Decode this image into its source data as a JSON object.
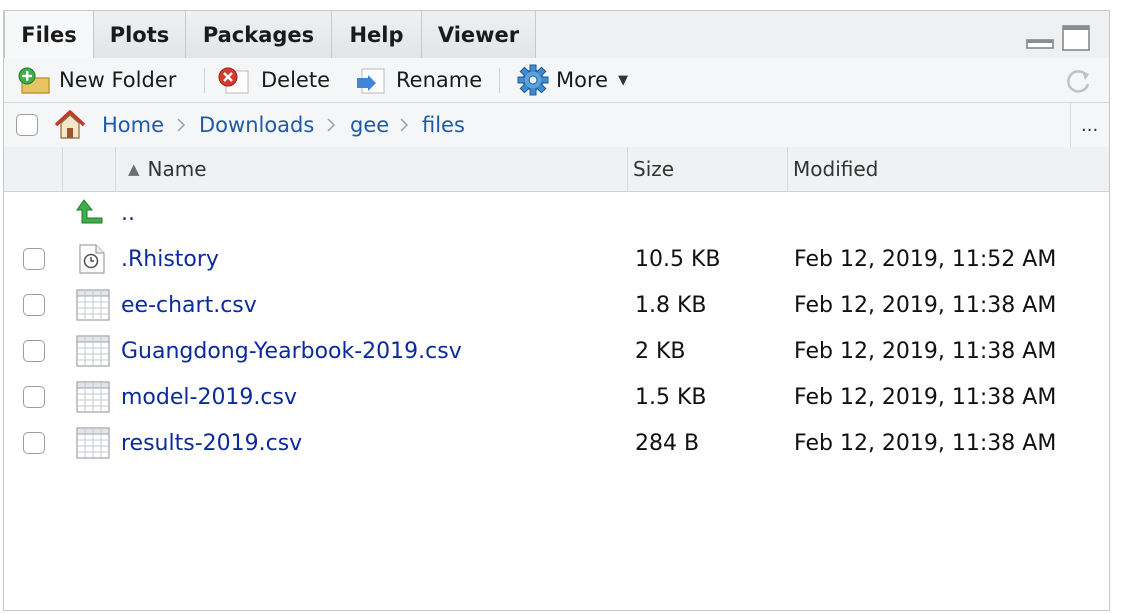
{
  "tabs": [
    {
      "label": "Files",
      "active": true
    },
    {
      "label": "Plots",
      "active": false
    },
    {
      "label": "Packages",
      "active": false
    },
    {
      "label": "Help",
      "active": false
    },
    {
      "label": "Viewer",
      "active": false
    }
  ],
  "toolbar": {
    "new_folder_label": "New Folder",
    "delete_label": "Delete",
    "rename_label": "Rename",
    "more_label": "More",
    "overflow_label": "..."
  },
  "breadcrumb": [
    "Home",
    "Downloads",
    "gee",
    "files"
  ],
  "columns": {
    "name": "Name",
    "size": "Size",
    "modified": "Modified"
  },
  "parent_dir_label": "..",
  "files": [
    {
      "name": ".Rhistory",
      "size": "10.5 KB",
      "modified": "Feb 12, 2019, 11:52 AM",
      "icon": "history-file-icon"
    },
    {
      "name": "ee-chart.csv",
      "size": "1.8 KB",
      "modified": "Feb 12, 2019, 11:38 AM",
      "icon": "csv-file-icon"
    },
    {
      "name": "Guangdong-Yearbook-2019.csv",
      "size": "2 KB",
      "modified": "Feb 12, 2019, 11:38 AM",
      "icon": "csv-file-icon"
    },
    {
      "name": "model-2019.csv",
      "size": "1.5 KB",
      "modified": "Feb 12, 2019, 11:38 AM",
      "icon": "csv-file-icon"
    },
    {
      "name": "results-2019.csv",
      "size": "284 B",
      "modified": "Feb 12, 2019, 11:38 AM",
      "icon": "csv-file-icon"
    }
  ],
  "colors": {
    "link": "#0b2b9c",
    "breadcrumb_link": "#1f5aa8",
    "tab_bg": "#eef0f2"
  }
}
